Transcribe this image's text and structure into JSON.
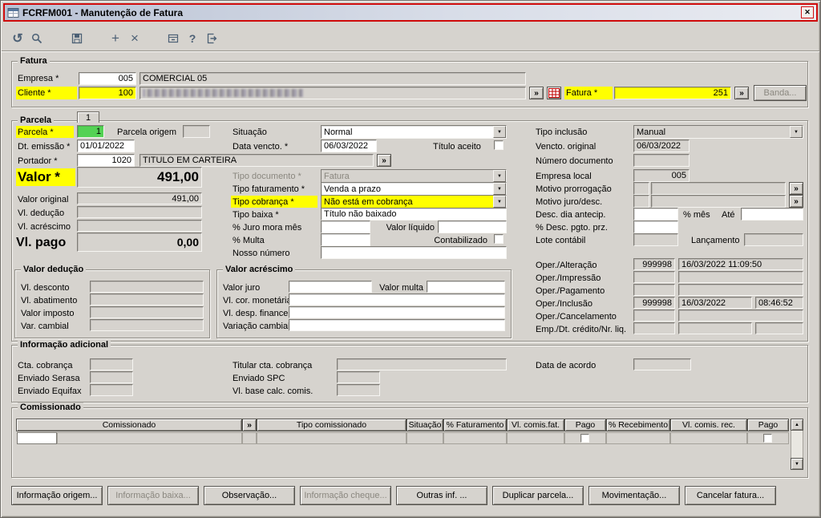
{
  "ui": {
    "lookup": "»",
    "arrow": "▼",
    "up": "▲",
    "down": "▼",
    "close": "✕",
    "plus": "+",
    "cross": "×",
    "undo": "↺",
    "help": "?"
  },
  "window": {
    "title": "FCRFM001 - Manutenção de Fatura"
  },
  "fatura": {
    "legend": "Fatura",
    "empresa_label": "Empresa *",
    "empresa_code": "005",
    "empresa_name": "COMERCIAL 05",
    "cliente_label": "Cliente *",
    "cliente_code": "100",
    "fatura_label": "Fatura *",
    "fatura_value": "251",
    "banda_button": "Banda..."
  },
  "parcela": {
    "legend": "Parcela",
    "tab": "1",
    "parcela_label": "Parcela *",
    "parcela_value": "1",
    "parcela_origem_label": "Parcela origem",
    "dt_emissao_label": "Dt. emissão *",
    "dt_emissao_value": "01/01/2022",
    "portador_label": "Portador *",
    "portador_code": "1020",
    "portador_name": "TITULO EM CARTEIRA",
    "valor_label": "Valor *",
    "valor_value": "491,00",
    "valor_original_label": "Valor original",
    "valor_original_value": "491,00",
    "vl_deducao_label": "Vl. dedução",
    "vl_acrescimo_label": "Vl. acréscimo",
    "vl_pago_label": "Vl. pago",
    "vl_pago_value": "0,00",
    "situacao_label": "Situação",
    "situacao_value": "Normal",
    "data_vencto_label": "Data vencto. *",
    "data_vencto_value": "06/03/2022",
    "titulo_aceito_label": "Título aceito",
    "tipo_documento_label": "Tipo documento *",
    "tipo_documento_value": "Fatura",
    "tipo_faturamento_label": "Tipo faturamento *",
    "tipo_faturamento_value": "Venda a prazo",
    "tipo_cobranca_label": "Tipo cobrança *",
    "tipo_cobranca_value": "Não está em cobrança",
    "tipo_baixa_label": "Tipo baixa *",
    "tipo_baixa_value": "Título não baixado",
    "juro_mora_label": "% Juro mora mês",
    "valor_liquido_label": "Valor líquido",
    "multa_label": "% Multa",
    "contabilizado_label": "Contabilizado",
    "nosso_numero_label": "Nosso número",
    "tipo_inclusao_label": "Tipo inclusão",
    "tipo_inclusao_value": "Manual",
    "vencto_original_label": "Vencto. original",
    "vencto_original_value": "06/03/2022",
    "numero_documento_label": "Número documento",
    "empresa_local_label": "Empresa local",
    "empresa_local_value": "005",
    "motivo_prorrogacao_label": "Motivo prorrogação",
    "motivo_juro_label": "Motivo juro/desc.",
    "desc_dia_label": "Desc. dia antecip.",
    "pct_mes_label": "% mês",
    "ate_label": "Até",
    "desc_pgto_label": "% Desc. pgto. prz.",
    "lote_label": "Lote contábil",
    "lancamento_label": "Lançamento",
    "oper_alteracao_label": "Oper./Alteração",
    "oper_alteracao_code": "999998",
    "oper_alteracao_datetime": "16/03/2022 11:09:50",
    "oper_impressao_label": "Oper./Impressão",
    "oper_pagamento_label": "Oper./Pagamento",
    "oper_inclusao_label": "Oper./Inclusão",
    "oper_inclusao_code": "999998",
    "oper_inclusao_date": "16/03/2022",
    "oper_inclusao_time": "08:46:52",
    "oper_cancelamento_label": "Oper./Cancelamento",
    "emp_dt_credito_label": "Emp./Dt. crédito/Nr. liq."
  },
  "valor_deducao": {
    "legend": "Valor dedução",
    "vl_desconto": "Vl. desconto",
    "vl_abatimento": "Vl. abatimento",
    "valor_imposto": "Valor imposto",
    "var_cambial": "Var. cambial"
  },
  "valor_acrescimo": {
    "legend": "Valor acréscimo",
    "valor_juro": "Valor juro",
    "valor_multa": "Valor multa",
    "vl_cor_monetaria": "Vl. cor. monetária",
    "vl_desp_financeira": "Vl. desp. financeira",
    "variacao_cambial": "Variação cambial"
  },
  "info_adicional": {
    "legend": "Informação adicional",
    "cta_cobranca": "Cta. cobrança",
    "enviado_serasa": "Enviado Serasa",
    "enviado_equifax": "Enviado Equifax",
    "titular_cta": "Titular cta. cobrança",
    "enviado_spc": "Enviado SPC",
    "vl_base_calc": "Vl. base calc. comis.",
    "data_acordo": "Data de acordo"
  },
  "comissionado": {
    "legend": "Comissionado",
    "headers": [
      "Comissionado",
      "»",
      "Tipo comissionado",
      "Situação",
      "% Faturamento",
      "Vl. comis.fat.",
      "Pago",
      "% Recebimento",
      "Vl. comis. rec.",
      "Pago"
    ]
  },
  "buttons": {
    "info_origem": "Informação origem...",
    "info_baixa": "Informação baixa...",
    "observacao": "Observação...",
    "info_cheque": "Informação cheque...",
    "outras_inf": "Outras inf. ...",
    "duplicar": "Duplicar parcela...",
    "movimentacao": "Movimentação...",
    "cancelar": "Cancelar fatura..."
  }
}
